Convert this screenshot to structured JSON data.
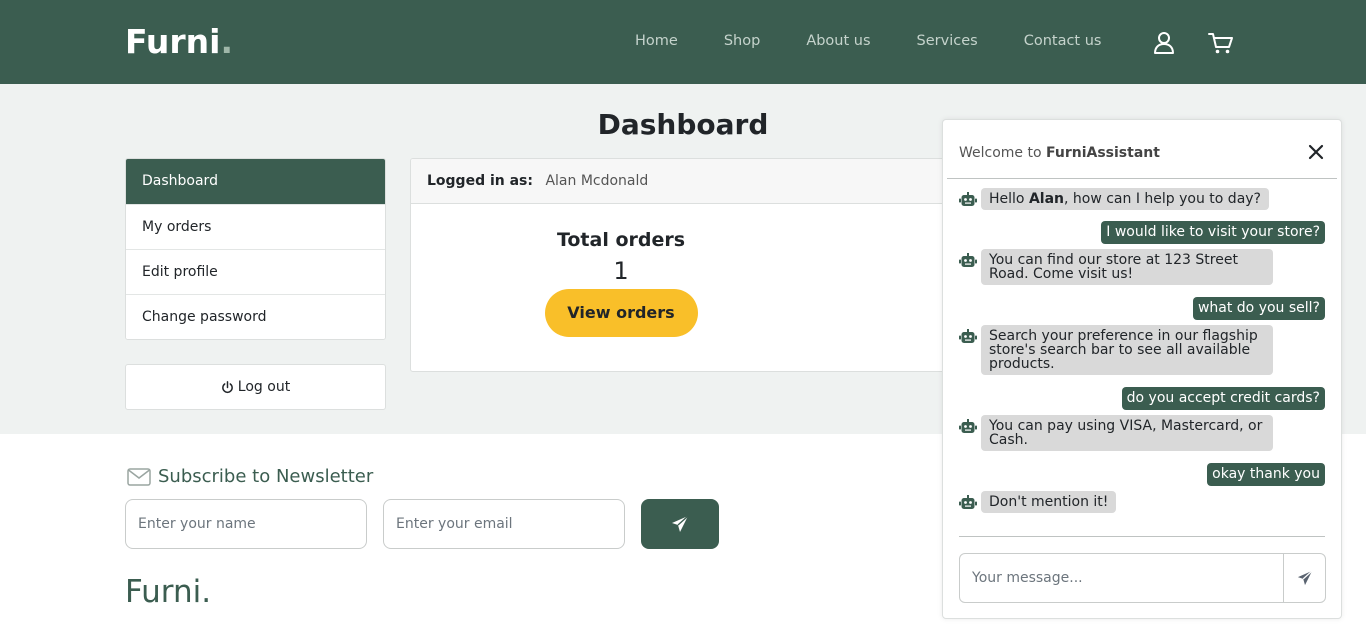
{
  "navbar": {
    "brand": "Furni",
    "brand_dot": ".",
    "links": [
      "Home",
      "Shop",
      "About us",
      "Services",
      "Contact us"
    ]
  },
  "page": {
    "title": "Dashboard"
  },
  "sidebar": {
    "items": [
      {
        "label": "Dashboard",
        "active": true
      },
      {
        "label": "My orders",
        "active": false
      },
      {
        "label": "Edit profile",
        "active": false
      },
      {
        "label": "Change password",
        "active": false
      }
    ],
    "logout_label": "Log out"
  },
  "account": {
    "logged_in_label": "Logged in as:",
    "user_name": "Alan Mcdonald",
    "total_orders_label": "Total orders",
    "total_orders_value": "1",
    "view_orders_label": "View orders"
  },
  "newsletter": {
    "title": "Subscribe to Newsletter",
    "name_placeholder": "Enter your name",
    "email_placeholder": "Enter your email"
  },
  "footer": {
    "brand": "Furni."
  },
  "chat": {
    "welcome_prefix": "Welcome to ",
    "assistant_name": "FurniAssistant",
    "greeting_before": "Hello ",
    "greeting_name": "Alan",
    "greeting_after": ", how can I help you to day?",
    "messages": [
      {
        "from": "user",
        "text": "I would like to visit your store?"
      },
      {
        "from": "bot",
        "text": "You can find our store at 123 Street Road. Come visit us!"
      },
      {
        "from": "user",
        "text": "what do you sell?"
      },
      {
        "from": "bot",
        "text": "Search your preference in our flagship store's search bar to see all available products."
      },
      {
        "from": "user",
        "text": "do you accept credit cards?"
      },
      {
        "from": "bot",
        "text": "You can pay using VISA, Mastercard, or Cash."
      },
      {
        "from": "user",
        "text": "okay thank you"
      },
      {
        "from": "bot",
        "text": "Don't mention it!"
      }
    ],
    "input_placeholder": "Your message..."
  },
  "colors": {
    "primary": "#3b5d50",
    "accent": "#f9bf29",
    "background": "#eff2f1",
    "bot_bubble": "#d9d9d9"
  }
}
